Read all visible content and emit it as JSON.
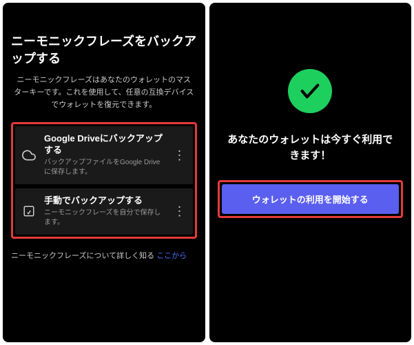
{
  "left": {
    "title": "ニーモニックフレーズをバックアップする",
    "description": "ニーモニックフレーズはあなたのウォレットのマスターキーです。これを使用して、任意の互換デバイスでウォレットを復元できます。",
    "options": [
      {
        "icon": "cloud",
        "title": "Google Driveにバックアップする",
        "desc": "バックアップファイルをGoogle Driveに保存します。"
      },
      {
        "icon": "edit",
        "title": "手動でバックアップする",
        "desc": "ニーモニックフレーズを自分で保存します。"
      }
    ],
    "learn_more_prefix": "ニーモニックフレーズについて詳しく知る ",
    "learn_more_link": "ここから"
  },
  "right": {
    "ready_text": "あなたのウォレットは今すぐ利用できます！",
    "button_label": "ウォレットの利用を開始する"
  }
}
